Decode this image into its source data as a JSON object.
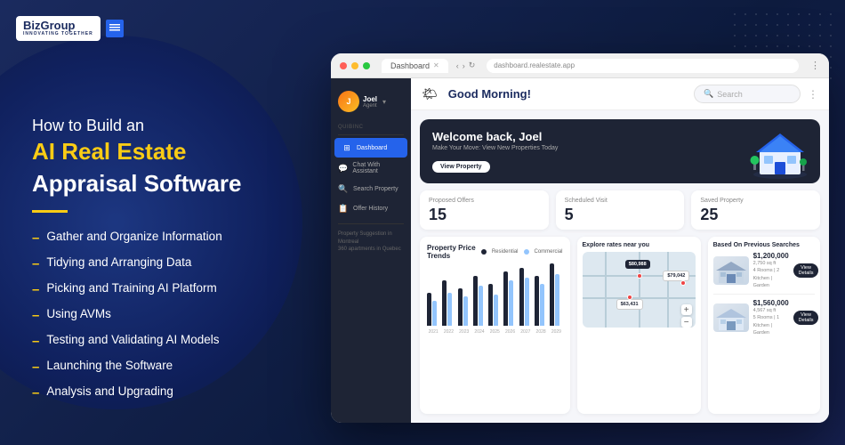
{
  "brand": {
    "name": "BizGroup",
    "tagline": "INNOVATING TOGETHER",
    "logo_letter": "B"
  },
  "left_content": {
    "headline_prefix": "How to Build an",
    "headline_main": "AI Real Estate",
    "headline_main2": "Appraisal Software",
    "bullets": [
      "Gather and Organize Information",
      "Tidying and Arranging Data",
      "Picking and Training AI Platform",
      "Using AVMs",
      "Testing and Validating AI Models",
      "Launching the Software",
      "Analysis and Upgrading"
    ]
  },
  "app": {
    "browser_tab": "Dashboard",
    "url": "dashboard.realestate.app",
    "greeting": "Good Morning!",
    "greeting_icon": "🌤",
    "welcome_title": "Welcome back, Joel",
    "welcome_subtitle": "Make Your Move: View New Properties Today",
    "view_property_btn": "View Property",
    "search_placeholder": "Search",
    "user": {
      "name": "Joel",
      "role": "Agent"
    },
    "sidebar_items": [
      {
        "label": "Dashboard",
        "icon": "⊞",
        "active": true
      },
      {
        "label": "Chat With Assistant",
        "icon": "💬",
        "active": false
      },
      {
        "label": "Search Property",
        "icon": "🔍",
        "active": false
      },
      {
        "label": "Offer History",
        "icon": "📋",
        "active": false
      }
    ],
    "sidebar_section": "QuiBinc",
    "stats": [
      {
        "label": "Proposed Offers",
        "value": "15"
      },
      {
        "label": "Scheduled Visit",
        "value": "5"
      },
      {
        "label": "Saved Property",
        "value": "25"
      }
    ],
    "chart": {
      "title": "Property Price Trends",
      "legend": [
        {
          "label": "Residential",
          "color": "#1e2435"
        },
        {
          "label": "Commercial",
          "color": "#93c5fd"
        }
      ],
      "years": [
        "2021",
        "2022",
        "2023",
        "2024",
        "2025",
        "2026",
        "2027",
        "2028",
        "2029"
      ],
      "bars": [
        {
          "residential": 40,
          "commercial": 30
        },
        {
          "residential": 55,
          "commercial": 40
        },
        {
          "residential": 45,
          "commercial": 35
        },
        {
          "residential": 60,
          "commercial": 48
        },
        {
          "residential": 50,
          "commercial": 38
        },
        {
          "residential": 65,
          "commercial": 55
        },
        {
          "residential": 70,
          "commercial": 58
        },
        {
          "residential": 60,
          "commercial": 50
        },
        {
          "residential": 75,
          "commercial": 62
        }
      ]
    },
    "map": {
      "title": "Explore rates near you",
      "prices": [
        {
          "label": "$80,988",
          "type": "dark"
        },
        {
          "label": "$79,042",
          "type": "light"
        },
        {
          "label": "$63,431",
          "type": "light"
        }
      ]
    },
    "properties": {
      "title": "Based On Previous Searches",
      "items": [
        {
          "price": "$1,200,000",
          "details": "4 Rooms | 2 Kitchen | Garden",
          "size": "2,750 sq ft",
          "btn": "View Details"
        },
        {
          "price": "$1,560,000",
          "details": "5 Rooms | 1 Kitchen | Garden",
          "size": "4,567 sq ft",
          "btn": "View Details"
        }
      ]
    }
  }
}
